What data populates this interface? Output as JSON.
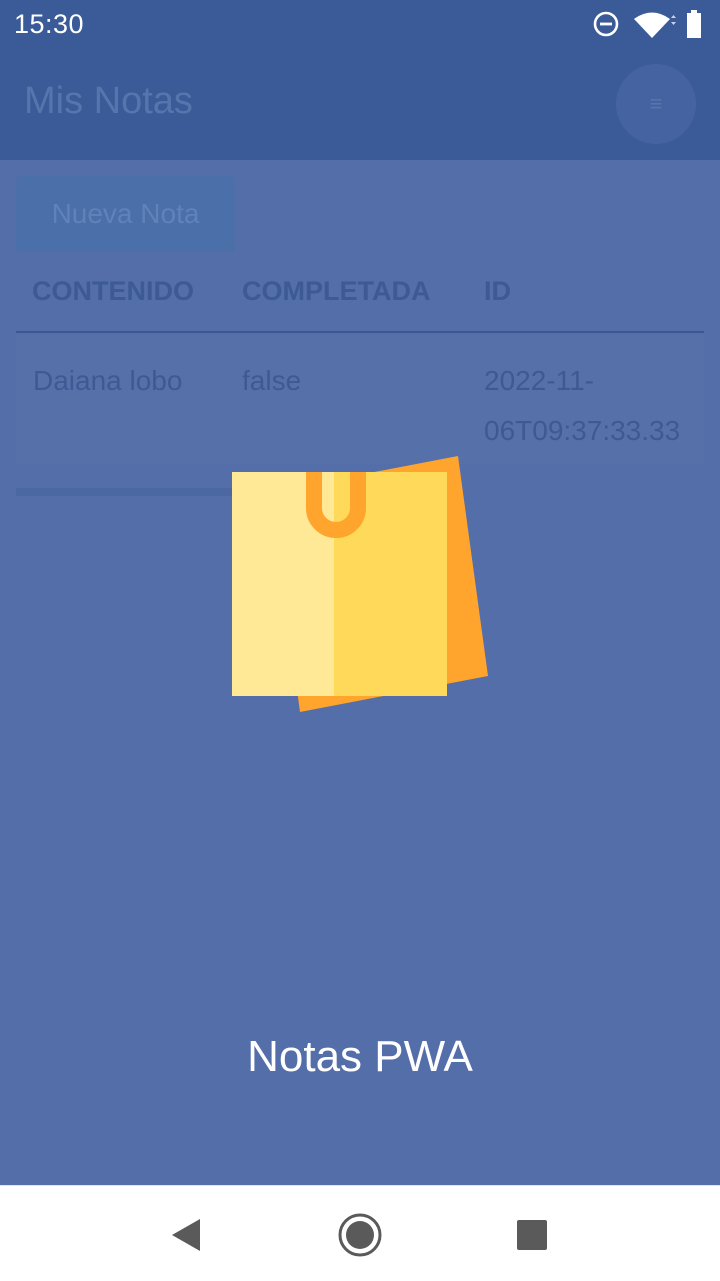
{
  "status_bar": {
    "time": "15:30",
    "icons": [
      "do-not-disturb-icon",
      "wifi-icon",
      "battery-icon"
    ]
  },
  "app": {
    "title": "Mis Notas",
    "menu_icon": "≡"
  },
  "toolbar": {
    "new_note_label": "Nueva Nota"
  },
  "table": {
    "headers": [
      "CONTENIDO",
      "COMPLETADA",
      "ID"
    ],
    "rows": [
      {
        "contenido": "Daiana lobo",
        "completada": "false",
        "id_line1": "2022-11-",
        "id_line2": "06T09:37:33.33"
      }
    ]
  },
  "splash": {
    "title": "Notas PWA",
    "logo_icon": "sticky-notes-icon"
  },
  "nav": {
    "icons": [
      "back-icon",
      "home-icon",
      "recents-icon"
    ]
  },
  "colors": {
    "header": "#3a5a98",
    "overlay": "#536ea8",
    "note_yellow": "#ffd95a",
    "note_orange": "#ffa42d"
  }
}
